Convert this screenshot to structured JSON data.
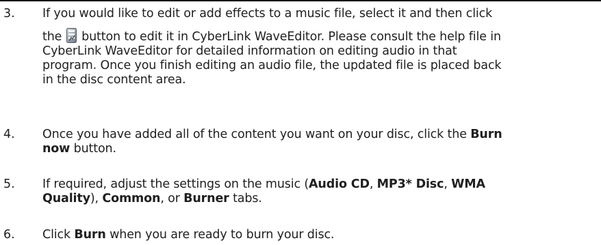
{
  "steps": [
    {
      "number": "3.",
      "line1": "If you would like to edit or add effects to a music file, select it and then click",
      "line2_before_icon": "the",
      "icon": "wave-editor-icon",
      "line2_after_icon": "button to edit it in CyberLink WaveEditor. Please consult the help file in",
      "line3": "CyberLink WaveEditor for detailed information on editing audio in that",
      "line4": "program. Once you finish editing an audio file, the updated file is placed back",
      "line5": "in the disc content area."
    },
    {
      "number": "4.",
      "line1_text": "Once you have added all of the content you want on your disc, click the",
      "line1_bold": "Burn",
      "line2_bold": "now",
      "line2_text": "button."
    },
    {
      "number": "5.",
      "t1": "If required, adjust the settings on the music (",
      "b1": "Audio CD",
      "t2": ", ",
      "b2": "MP3* Disc",
      "t3": ", ",
      "b3": "WMA",
      "b4": "Quality",
      "t4": "), ",
      "b5": "Common",
      "t5": ", or ",
      "b6": "Burner",
      "t6": " tabs."
    },
    {
      "number": "6.",
      "t1": "Click ",
      "b1": "Burn",
      "t2": " when you are ready to burn your disc."
    }
  ]
}
